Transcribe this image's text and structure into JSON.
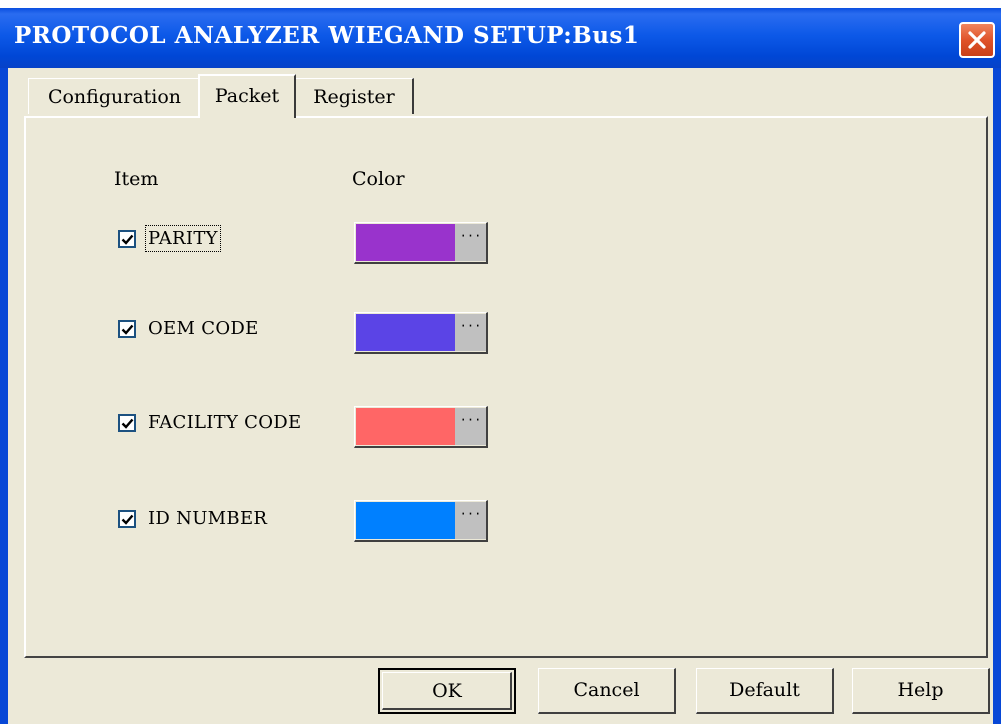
{
  "window": {
    "title": "PROTOCOL ANALYZER WIEGAND SETUP:Bus1"
  },
  "tabs": [
    {
      "label": "Configuration",
      "active": false
    },
    {
      "label": "Packet",
      "active": true
    },
    {
      "label": "Register",
      "active": false
    }
  ],
  "packet": {
    "header_item": "Item",
    "header_color": "Color",
    "rows": [
      {
        "label": "PARITY",
        "checked": true,
        "color": "#9933cc",
        "more": "···"
      },
      {
        "label": "OEM CODE",
        "checked": true,
        "color": "#5b44e6",
        "more": "···"
      },
      {
        "label": "FACILITY CODE",
        "checked": true,
        "color": "#ff6666",
        "more": "···"
      },
      {
        "label": "ID NUMBER",
        "checked": true,
        "color": "#0080ff",
        "more": "···"
      }
    ]
  },
  "buttons": {
    "ok": "OK",
    "cancel": "Cancel",
    "default": "Default",
    "help": "Help"
  },
  "icons": {
    "close": "close-icon",
    "check": "checkmark-icon"
  }
}
